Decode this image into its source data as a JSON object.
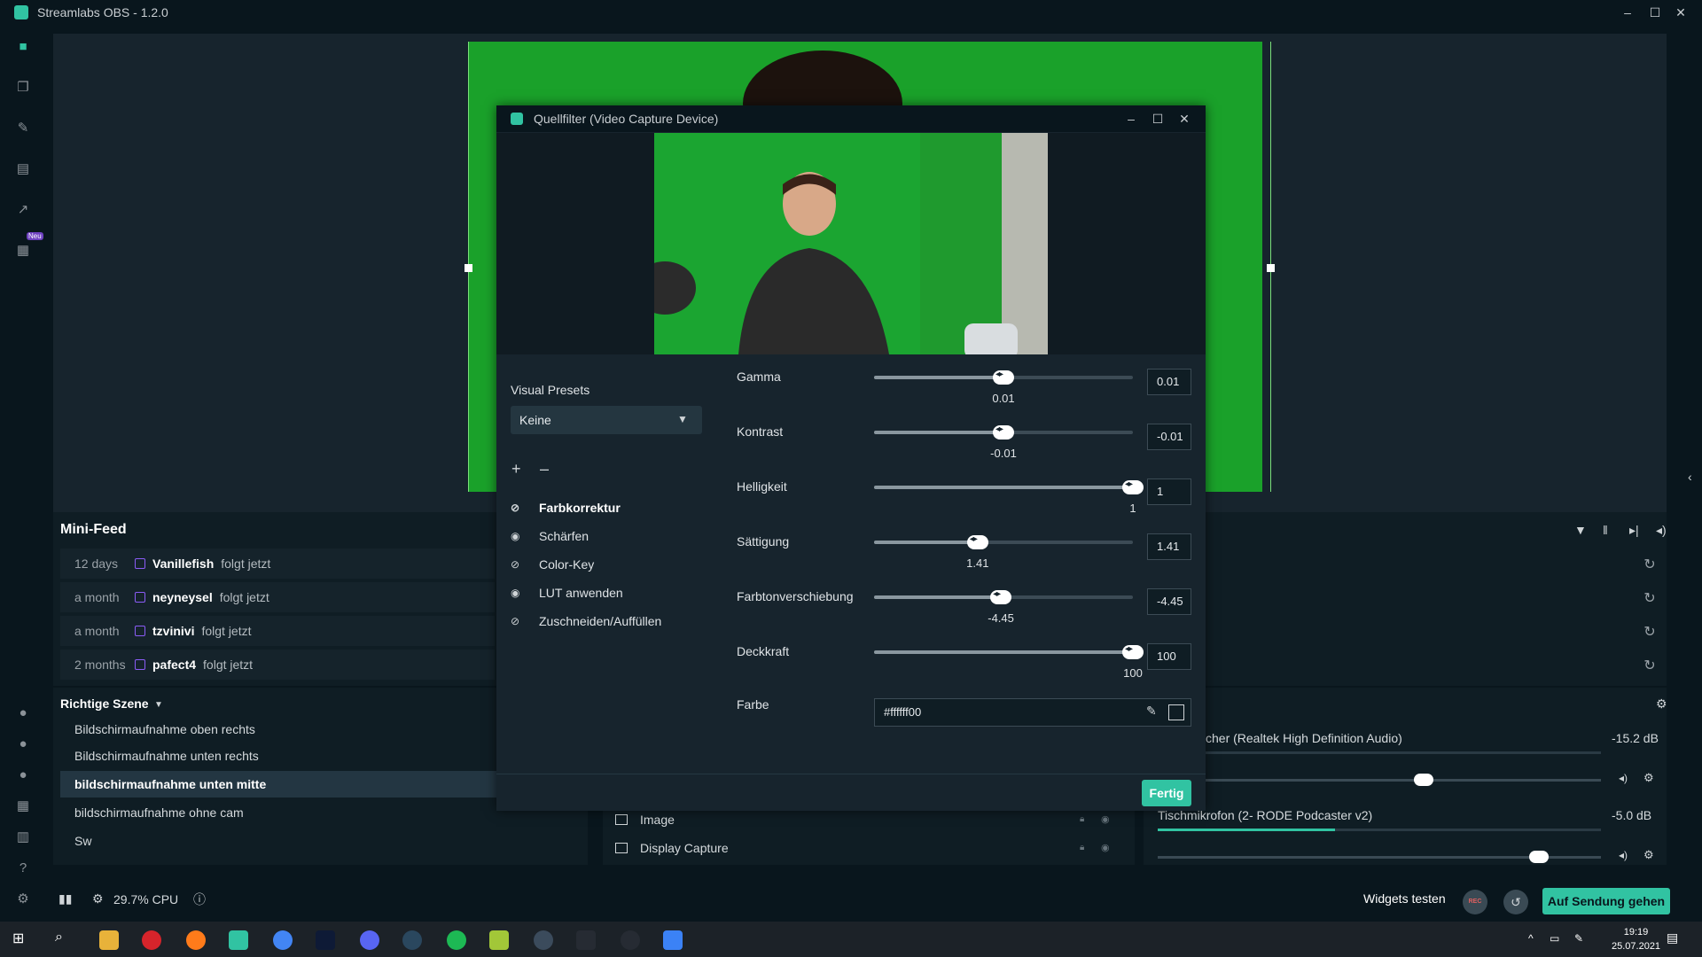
{
  "app": {
    "title": "Streamlabs OBS - 1.2.0"
  },
  "nav": {
    "badge": "Neu"
  },
  "dialog": {
    "title": "Quellfilter (Video Capture Device)",
    "visual_presets_label": "Visual Presets",
    "preset_value": "Keine",
    "add": "+",
    "remove": "–",
    "filters": [
      {
        "label": "Farbkorrektur",
        "icon": "eye-off-icon",
        "active": true
      },
      {
        "label": "Schärfen",
        "icon": "eye-icon",
        "active": false
      },
      {
        "label": "Color-Key",
        "icon": "eye-off-icon",
        "active": false
      },
      {
        "label": "LUT anwenden",
        "icon": "eye-icon",
        "active": false
      },
      {
        "label": "Zuschneiden/Auffüllen",
        "icon": "eye-off-icon",
        "active": false
      }
    ],
    "settings": [
      {
        "label": "Gamma",
        "value": "0.01",
        "fraction": 0.5
      },
      {
        "label": "Kontrast",
        "value": "-0.01",
        "fraction": 0.5
      },
      {
        "label": "Helligkeit",
        "value": "1",
        "fraction": 1.0
      },
      {
        "label": "Sättigung",
        "value": "1.41",
        "fraction": 0.4
      },
      {
        "label": "Farbtonverschiebung",
        "value": "-4.45",
        "fraction": 0.49
      },
      {
        "label": "Deckkraft",
        "value": "100",
        "fraction": 1.0
      }
    ],
    "color_label": "Farbe",
    "color_value": "#ffffff00",
    "done_label": "Fertig"
  },
  "minifeed": {
    "title": "Mini-Feed",
    "rows": [
      {
        "time": "12 days",
        "user": "Vanillefish",
        "action": "folgt jetzt"
      },
      {
        "time": "a month",
        "user": "neyneysel",
        "action": "folgt jetzt"
      },
      {
        "time": "a month",
        "user": "tzvinivi",
        "action": "folgt jetzt"
      },
      {
        "time": "2 months",
        "user": "pafect4",
        "action": "folgt jetzt"
      }
    ]
  },
  "scenes": {
    "title": "Richtige Szene",
    "items": [
      "Bildschirmaufnahme oben rechts",
      "Bildschirmaufnahme unten rechts",
      "bildschirmaufnahme unten mitte",
      "bildschirmaufnahme ohne cam",
      "Sw"
    ],
    "selected_index": 2
  },
  "sources": {
    "items": [
      {
        "label": "Image",
        "icon": "image-icon"
      },
      {
        "label": "Display Capture",
        "icon": "monitor-icon"
      }
    ]
  },
  "mixer": {
    "channels": [
      {
        "name": "cher (Realtek High Definition Audio)",
        "db": "-15.2 dB",
        "level": 0.6
      },
      {
        "name": "Tischmikrofon (2- RODE Podcaster v2)",
        "db": "-5.0 dB",
        "level": 0.86
      }
    ]
  },
  "status": {
    "cpu": "29.7% CPU",
    "widgets": "Widgets testen",
    "rec": "REC",
    "go_live": "Auf Sendung gehen"
  },
  "taskbar": {
    "time": "19:19",
    "date": "25.07.2021"
  },
  "colors": {
    "accent": "#31c3a2",
    "chroma": "#1aa12a"
  }
}
